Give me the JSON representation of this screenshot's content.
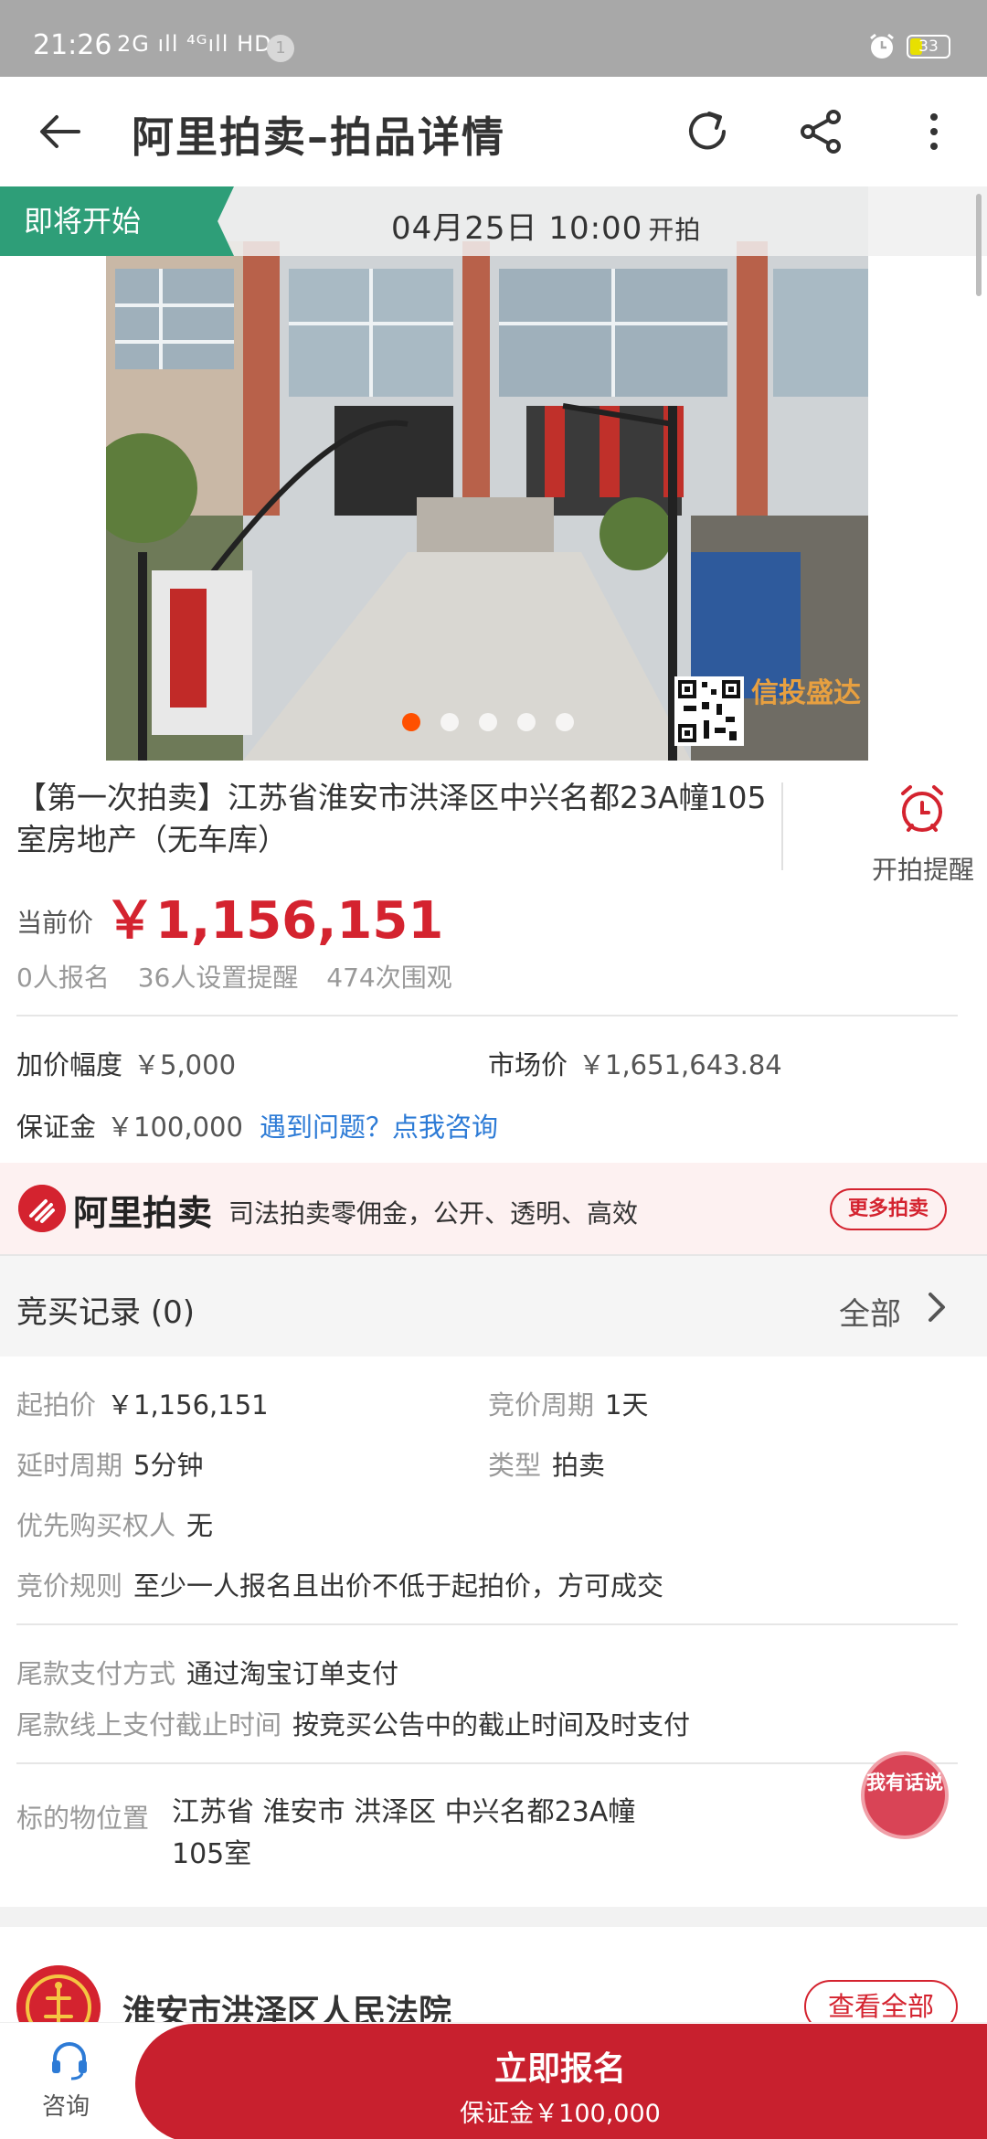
{
  "status_bar": {
    "time": "21:26",
    "signal_text": "2G ıll ⁴ᴳıll HD",
    "notification_count": "1",
    "battery": "33",
    "battery_fraction": 0.33
  },
  "nav": {
    "title": "阿里拍卖–拍品详情",
    "more_badge": "···",
    "icons": [
      "back-arrow-icon",
      "refresh-icon",
      "share-icon",
      "more-vertical-icon"
    ]
  },
  "hero": {
    "tag": "即将开始",
    "start_date": "04月25日 10:00",
    "start_suffix": "开拍",
    "carousel_count": 5,
    "carousel_active_index": 0,
    "watermark": "信投盛达",
    "colors": {
      "tag_bg": "#2e9e78",
      "active_dot": "#ff5000"
    }
  },
  "lot": {
    "title": "【第一次拍卖】江苏省淮安市洪泽区中兴名都23A幢105室房地产（无车库）",
    "remind_label": "开拍提醒",
    "current_price_label": "当前价",
    "current_price": "￥1,156,151",
    "stats": [
      "0人报名",
      "36人设置提醒",
      "474次围观"
    ],
    "increment_label": "加价幅度",
    "increment_value": "￥5,000",
    "market_label": "市场价",
    "market_value": "￥1,651,643.84",
    "deposit_label": "保证金",
    "deposit_value": "￥100,000",
    "consult_link": "遇到问题？点我咨询"
  },
  "promo": {
    "brand": "阿里拍卖",
    "slogan": "司法拍卖零佣金，公开、透明、高效",
    "more_button": "更多拍卖",
    "color": "#d4232f"
  },
  "records": {
    "label": "竞买记录",
    "count": "(0)",
    "all_label": "全部"
  },
  "info": {
    "start_price_label": "起拍价",
    "start_price_value": "￥1,156,151",
    "period_label": "竞价周期",
    "period_value": "1天",
    "delay_label": "延时周期",
    "delay_value": "5分钟",
    "type_label": "类型",
    "type_value": "拍卖",
    "priority_label": "优先购买权人",
    "priority_value": "无",
    "rule_label": "竞价规则",
    "rule_value": "至少一人报名且出价不低于起拍价，方可成交",
    "payment_label": "尾款支付方式",
    "payment_value": "通过淘宝订单支付",
    "deadline_label": "尾款线上支付截止时间",
    "deadline_value": "按竞买公告中的截止时间及时支付",
    "location_label": "标的物位置",
    "location_value": "江苏省 淮安市 洪泽区 中兴名都23A幢105室"
  },
  "court": {
    "name": "淮安市洪泽区人民法院",
    "view_all": "查看全部"
  },
  "chat_bubble": {
    "text": "我有话说"
  },
  "bottom": {
    "consult_label": "咨询",
    "signup_label": "立即报名",
    "signup_sub": "保证金￥100,000",
    "button_color": "#c8202e"
  }
}
